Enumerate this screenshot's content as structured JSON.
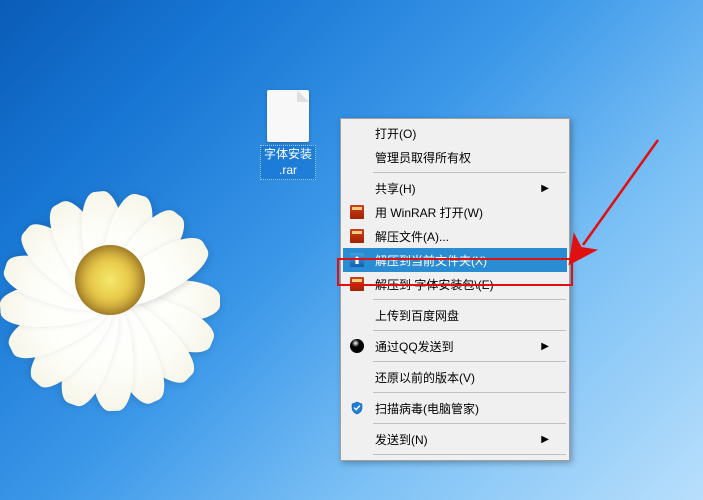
{
  "desktop_icon": {
    "label": "字体安装\n.rar"
  },
  "context_menu": {
    "items": [
      {
        "label": "打开(O)",
        "icon": null,
        "submenu": false,
        "selected": false,
        "separator_after": false
      },
      {
        "label": "管理员取得所有权",
        "icon": null,
        "submenu": false,
        "selected": false,
        "separator_after": true
      },
      {
        "label": "共享(H)",
        "icon": null,
        "submenu": true,
        "selected": false,
        "separator_after": false
      },
      {
        "label": "用 WinRAR 打开(W)",
        "icon": "rar",
        "submenu": false,
        "selected": false,
        "separator_after": false
      },
      {
        "label": "解压文件(A)...",
        "icon": "rar",
        "submenu": false,
        "selected": false,
        "separator_after": false
      },
      {
        "label": "解压到当前文件夹(X)",
        "icon": "extract",
        "submenu": false,
        "selected": true,
        "separator_after": false
      },
      {
        "label": "解压到 字体安装包\\(E)",
        "icon": "rar",
        "submenu": false,
        "selected": false,
        "separator_after": true
      },
      {
        "label": "上传到百度网盘",
        "icon": null,
        "submenu": false,
        "selected": false,
        "separator_after": true
      },
      {
        "label": "通过QQ发送到",
        "icon": "qq",
        "submenu": true,
        "selected": false,
        "separator_after": true
      },
      {
        "label": "还原以前的版本(V)",
        "icon": null,
        "submenu": false,
        "selected": false,
        "separator_after": true
      },
      {
        "label": "扫描病毒(电脑管家)",
        "icon": "shield",
        "submenu": false,
        "selected": false,
        "separator_after": true
      },
      {
        "label": "发送到(N)",
        "icon": null,
        "submenu": true,
        "selected": false,
        "separator_after": true
      }
    ]
  }
}
